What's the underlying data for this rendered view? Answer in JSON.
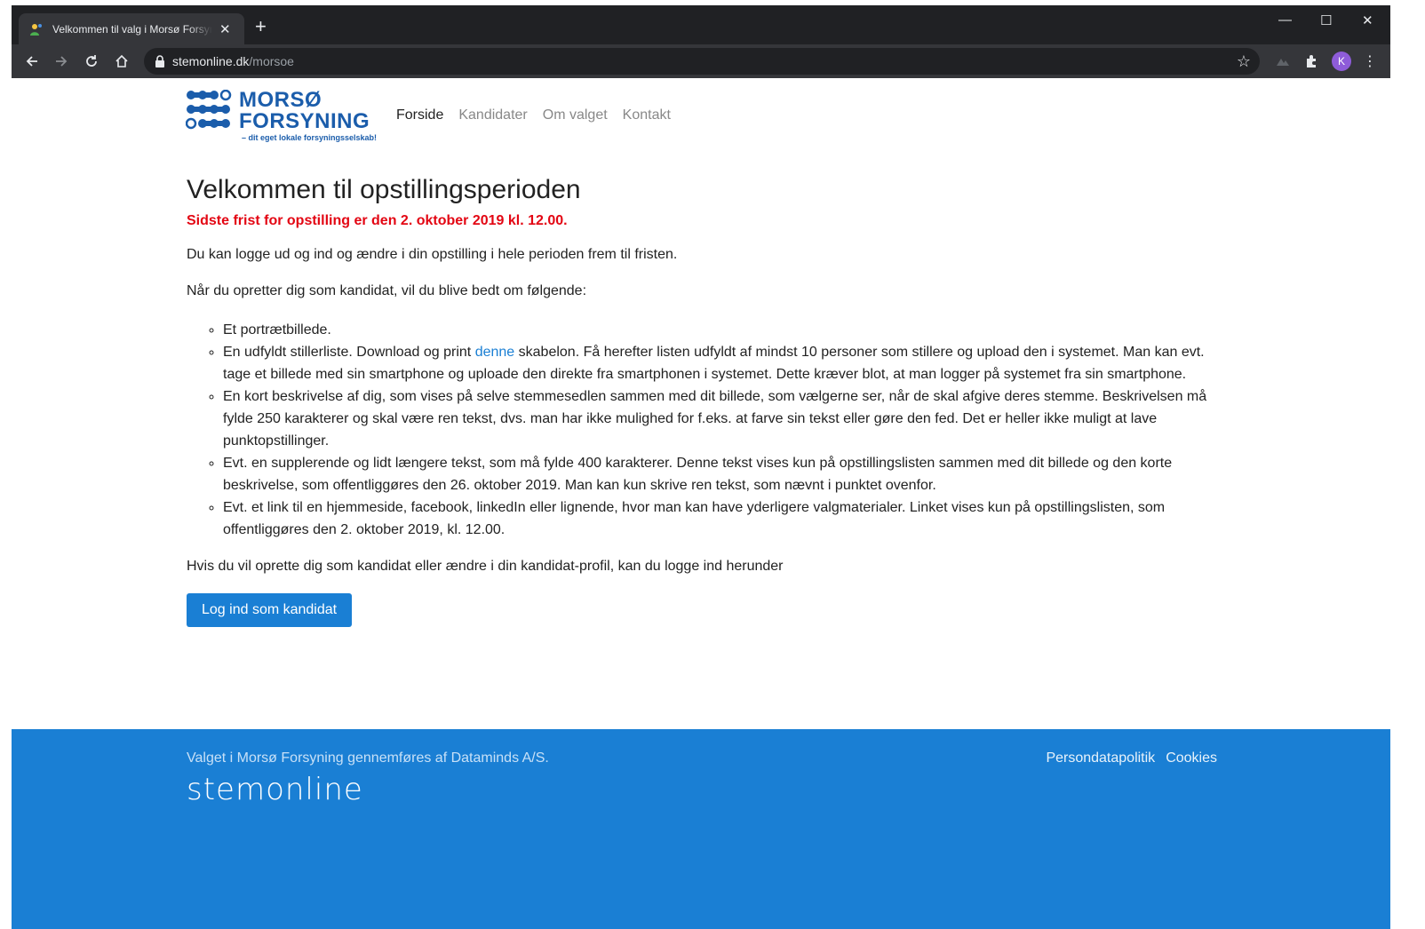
{
  "browser": {
    "tab_title": "Velkommen til valg i Morsø Forsyning",
    "url_host": "stemonline.dk",
    "url_path": "/morsoe",
    "avatar_letter": "K"
  },
  "logo": {
    "line1": "MORSØ",
    "line2": "FORSYNING",
    "tagline": "– dit eget lokale forsyningsselskab!",
    "color": "#1b5dab"
  },
  "nav": {
    "items": [
      "Forside",
      "Kandidater",
      "Om valget",
      "Kontakt"
    ],
    "active": "Forside"
  },
  "main": {
    "title": "Velkommen til opstillingsperioden",
    "deadline": "Sidste frist for opstilling er den 2. oktober 2019 kl. 12.00.",
    "intro": "Du kan logge ud og ind og ændre i din opstilling i hele perioden frem til fristen.",
    "list_intro": "Når du opretter dig som kandidat, vil du blive bedt om følgende:",
    "items": {
      "i1": "Et portrætbillede.",
      "i2_before": "En udfyldt stillerliste. Download og print ",
      "i2_link": "denne",
      "i2_after": " skabelon. Få herefter listen udfyldt af mindst 10 personer som stillere og upload den i systemet. Man kan evt. tage et billede med sin smartphone og uploade den direkte fra smartphonen i systemet. Dette kræver blot, at man logger på systemet fra sin smartphone.",
      "i3": "En kort beskrivelse af dig, som vises på selve stemmesedlen sammen med dit billede, som vælgerne ser, når de skal afgive deres stemme. Beskrivelsen må fylde 250 karakterer og skal være ren tekst, dvs. man har ikke mulighed for f.eks. at farve sin tekst eller gøre den fed. Det er heller ikke muligt at lave punktopstillinger.",
      "i4": "Evt. en supplerende og lidt længere tekst, som må fylde 400 karakterer. Denne tekst vises kun på opstillingslisten sammen med dit billede og den korte beskrivelse, som offentliggøres den 26. oktober 2019. Man kan kun skrive ren tekst, som nævnt i punktet ovenfor.",
      "i5": "Evt. et link til en hjemmeside, facebook, linkedIn eller lignende, hvor man kan have yderligere valgmaterialer. Linket vises kun på opstillingslisten, som offentliggøres den 2. oktober 2019, kl. 12.00."
    },
    "login_text": "Hvis du vil oprette dig som kandidat eller ændre i din kandidat-profil, kan du logge ind herunder",
    "login_button": "Log ind som kandidat"
  },
  "footer": {
    "text": "Valget i Morsø Forsyning gennemføres af Dataminds A/S.",
    "brand": "stemonline",
    "links": [
      "Persondatapolitik",
      "Cookies"
    ],
    "bg_color": "#1a7fd4"
  },
  "colors": {
    "accent": "#1a7fd4",
    "deadline_red": "#e30613"
  }
}
